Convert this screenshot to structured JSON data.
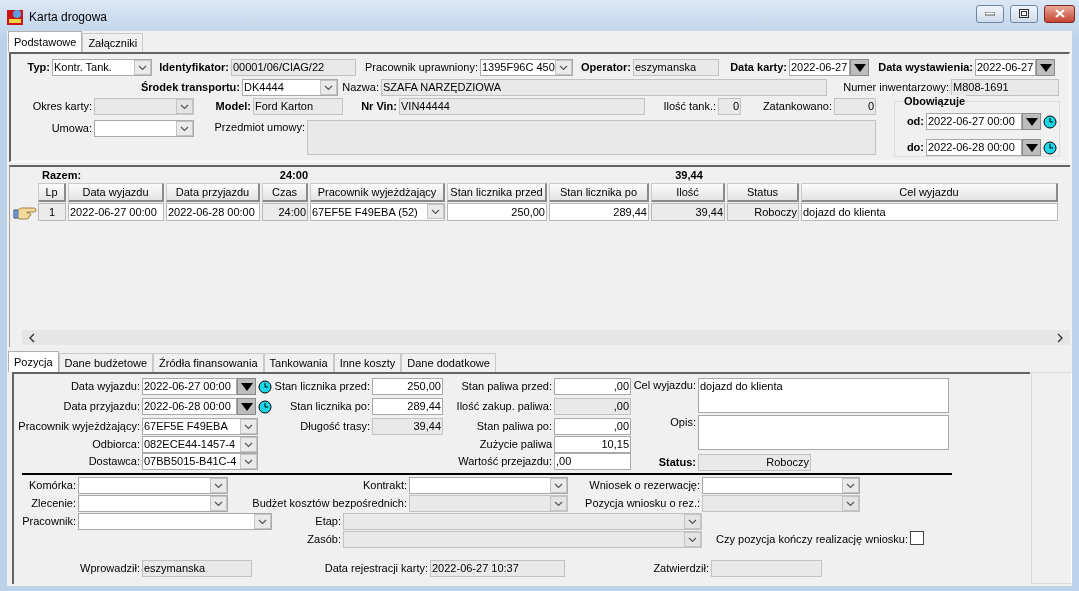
{
  "window": {
    "title": "Karta drogowa"
  },
  "tabs": [
    {
      "label": "Podstawowe",
      "selected": true
    },
    {
      "label": "Załączniki",
      "selected": false
    }
  ],
  "header": {
    "lines": [
      {
        "fields": [
          {
            "kind": "combo",
            "label": "Typ:",
            "value": "Kontr. Tank.",
            "disabled": false
          },
          {
            "kind": "text",
            "label": "Identyfikator:",
            "value": "00001/06/CIAG/22",
            "disabled": true
          },
          {
            "kind": "combo",
            "label": "Pracownik uprawniony:",
            "value": "1395F96C 450",
            "disabled": false
          },
          {
            "kind": "text",
            "label": "Operator:",
            "value": "eszymanska",
            "disabled": true
          },
          {
            "kind": "date",
            "label": "Data karty:",
            "value": "2022-06-27",
            "disabled": false
          },
          {
            "kind": "date",
            "label": "Data wystawienia:",
            "value": "2022-06-27",
            "disabled": false
          }
        ]
      },
      {
        "fields": [
          {
            "kind": "combo",
            "label": "Środek transportu:",
            "value": "DK4444",
            "disabled": false
          },
          {
            "kind": "text",
            "label": "Nazwa:",
            "value": "SZAFA NARZĘDZIOWA",
            "disabled": true
          },
          {
            "kind": "text",
            "label": "Numer inwentarzowy:",
            "value": "M808-1691",
            "disabled": true
          }
        ]
      },
      {
        "fields": [
          {
            "kind": "combo",
            "label": "Okres karty:",
            "disabled": true
          },
          {
            "kind": "text",
            "label": "Model:",
            "value": "Ford Karton",
            "disabled": true
          },
          {
            "kind": "text",
            "label": "Nr Vin:",
            "value": "VIN44444",
            "disabled": true
          },
          {
            "kind": "number",
            "label": "Ilość tank.:",
            "value": "0",
            "disabled": true
          },
          {
            "kind": "number",
            "label": "Zatankowano:",
            "value": "0",
            "disabled": true
          }
        ]
      },
      {
        "fields": [
          {
            "kind": "combo",
            "label": "Umowa:",
            "disabled": false
          },
          {
            "kind": "memo",
            "label": "Przedmiot umowy:",
            "disabled": true
          }
        ]
      }
    ],
    "validity": {
      "title": "Obowiązuje",
      "fields": [
        {
          "kind": "datetime",
          "label": "od:",
          "value": "2022-06-27 00:00",
          "disabled": false
        },
        {
          "kind": "datetime",
          "label": "do:",
          "value": "2022-06-28 00:00",
          "disabled": false
        }
      ]
    }
  },
  "table": {
    "totals": {
      "label": "Razem:",
      "time": "24:00",
      "quantity": "39,44"
    },
    "columns": [
      "Lp",
      "Data wyjazdu",
      "Data przyjazdu",
      "Czas",
      "Pracownik wyjeżdżający",
      "Stan licznika przed",
      "Stan licznika po",
      "Ilość",
      "Status",
      "Cel wyjazdu"
    ],
    "rows": [
      {
        "selected": true,
        "cells": [
          "1",
          "2022-06-27 00:00",
          "2022-06-28 00:00",
          "24:00",
          "67EF5E F49EBA (52)",
          "250,00",
          "289,44",
          "39,44",
          "Roboczy",
          "dojazd do klienta"
        ]
      }
    ]
  },
  "detail_tabs": [
    {
      "label": "Pozycja",
      "selected": true
    },
    {
      "label": "Dane budżetowe",
      "selected": false
    },
    {
      "label": "Źródła finansowania",
      "selected": false
    },
    {
      "label": "Tankowania",
      "selected": false
    },
    {
      "label": "Inne koszty",
      "selected": false
    },
    {
      "label": "Dane dodatkowe",
      "selected": false
    }
  ],
  "detail": {
    "sections": [
      {
        "fields": [
          {
            "kind": "datetime",
            "label": "Data wyjazdu:",
            "value": "2022-06-27 00:00",
            "disabled": false
          },
          {
            "kind": "datetime",
            "label": "Data przyjazdu:",
            "value": "2022-06-28 00:00",
            "disabled": false
          },
          {
            "kind": "combo",
            "label": "Pracownik wyjeżdżający:",
            "value": "67EF5E F49EBA",
            "disabled": false
          },
          {
            "kind": "combo",
            "label": "Odbiorca:",
            "value": "082ECE44-1457-4",
            "disabled": false
          },
          {
            "kind": "combo",
            "label": "Dostawca:",
            "value": "07BB5015-B41C-4",
            "disabled": false
          }
        ]
      },
      {
        "fields": [
          {
            "kind": "number",
            "label": "Stan licznika przed:",
            "value": "250,00",
            "disabled": false
          },
          {
            "kind": "number",
            "label": "Stan licznika po:",
            "value": "289,44",
            "disabled": false
          },
          {
            "kind": "number",
            "label": "Długość trasy:",
            "value": "39,44",
            "disabled": true
          }
        ]
      },
      {
        "fields": [
          {
            "kind": "number",
            "label": "Stan paliwa przed:",
            "value": ",00",
            "disabled": false
          },
          {
            "kind": "number",
            "label": "Ilość zakup. paliwa:",
            "value": ",00",
            "disabled": true
          },
          {
            "kind": "number",
            "label": "Stan paliwa po:",
            "value": ",00",
            "disabled": false
          },
          {
            "kind": "number",
            "label": "Zużycie paliwa",
            "value": "10,15",
            "disabled": false
          },
          {
            "kind": "text",
            "label": "Wartość przejazdu:",
            "value": ",00",
            "disabled": false
          }
        ]
      },
      {
        "fields": [
          {
            "kind": "memo",
            "label": "Cel wyjazdu:",
            "value": "dojazd do klienta",
            "disabled": false
          },
          {
            "kind": "memo",
            "label": "Opis:",
            "disabled": false
          },
          {
            "kind": "status",
            "label": "Status:",
            "value": "Roboczy",
            "disabled": true
          }
        ]
      }
    ],
    "lines": [
      {
        "fields": [
          {
            "kind": "combo",
            "label": "Komórka:",
            "disabled": false
          },
          {
            "kind": "combo",
            "label": "Kontrakt:",
            "disabled": false
          },
          {
            "kind": "combo",
            "label": "Wniosek o rezerwację:",
            "disabled": false
          }
        ]
      },
      {
        "fields": [
          {
            "kind": "combo",
            "label": "Zlecenie:",
            "disabled": false
          },
          {
            "kind": "combo",
            "label": "Budżet kosztów bezpośrednich:",
            "disabled": true
          },
          {
            "kind": "combo",
            "label": "Pozycja wniosku o rez.:",
            "disabled": true
          }
        ]
      },
      {
        "fields": [
          {
            "kind": "combo",
            "label": "Pracownik:",
            "disabled": false
          },
          {
            "kind": "combo",
            "label": "Etap:",
            "disabled": true
          }
        ]
      },
      {
        "fields": [
          {
            "kind": "combo",
            "label": "Zasób:",
            "disabled": true
          },
          {
            "kind": "checkbox",
            "label": "Czy pozycja kończy realizację wniosku:",
            "checked": false
          }
        ]
      },
      {
        "fields": [
          {
            "kind": "text",
            "label": "Wprowadził:",
            "value": "eszymanska",
            "disabled": true
          },
          {
            "kind": "text",
            "label": "Data rejestracji karty:",
            "value": "2022-06-27 10:37",
            "disabled": true
          },
          {
            "kind": "text",
            "label": "Zatwierdził:",
            "disabled": true
          }
        ]
      }
    ]
  }
}
